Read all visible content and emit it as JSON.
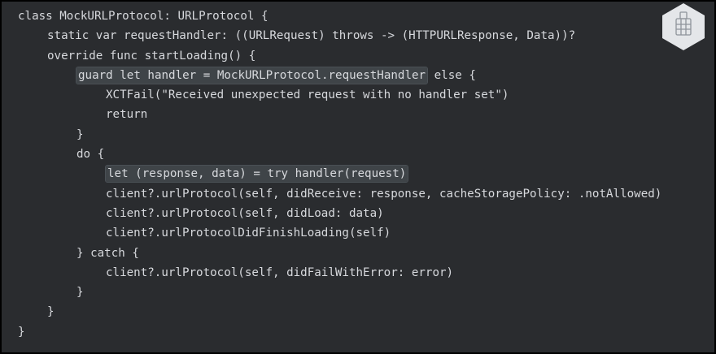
{
  "code": {
    "lines": [
      "class MockURLProtocol: URLProtocol {",
      "static var requestHandler: ((URLRequest) throws -> (HTTPURLResponse, Data))?",
      "override func startLoading() {",
      "guard let handler = MockURLProtocol.requestHandler else {",
      "XCTFail(\"Received unexpected request with no handler set\")",
      "return",
      "}",
      "do {",
      "let (response, data) = try handler(request)",
      "client?.urlProtocol(self, didReceive: response, cacheStoragePolicy: .notAllowed)",
      "client?.urlProtocol(self, didLoad: data)",
      "client?.urlProtocolDidFinishLoading(self)",
      "} catch {",
      "client?.urlProtocol(self, didFailWithError: error)",
      "}",
      "}",
      "}"
    ],
    "highlight_guard": "guard let handler = MockURLProtocol.requestHandler",
    "guard_tail": " else {",
    "highlight_let": "let (response, data) = try handler(request)"
  },
  "colors": {
    "background": "#2a2c2f",
    "frame": "#000000",
    "text": "#d7d9dd",
    "highlight": "#3f4448",
    "badge": "#e4e6e9"
  },
  "badge": {
    "icon": "building-grid-icon"
  }
}
